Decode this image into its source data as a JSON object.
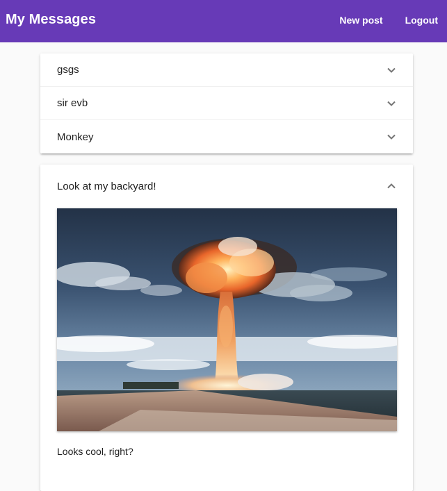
{
  "header": {
    "title": "My Messages",
    "new_post_label": "New post",
    "logout_label": "Logout"
  },
  "posts": [
    {
      "title": "gsgs",
      "expanded": false
    },
    {
      "title": "sir evb",
      "expanded": false
    },
    {
      "title": "Monkey",
      "expanded": false
    }
  ],
  "expanded_post": {
    "title": "Look at my backyard!",
    "image_icon": "mushroom-cloud-photo",
    "body": "Looks cool, right?",
    "expanded": true
  },
  "colors": {
    "toolbar": "#673ab7",
    "toolbar_text": "#ffffff",
    "page_background": "#fafafa",
    "card_background": "#ffffff"
  }
}
